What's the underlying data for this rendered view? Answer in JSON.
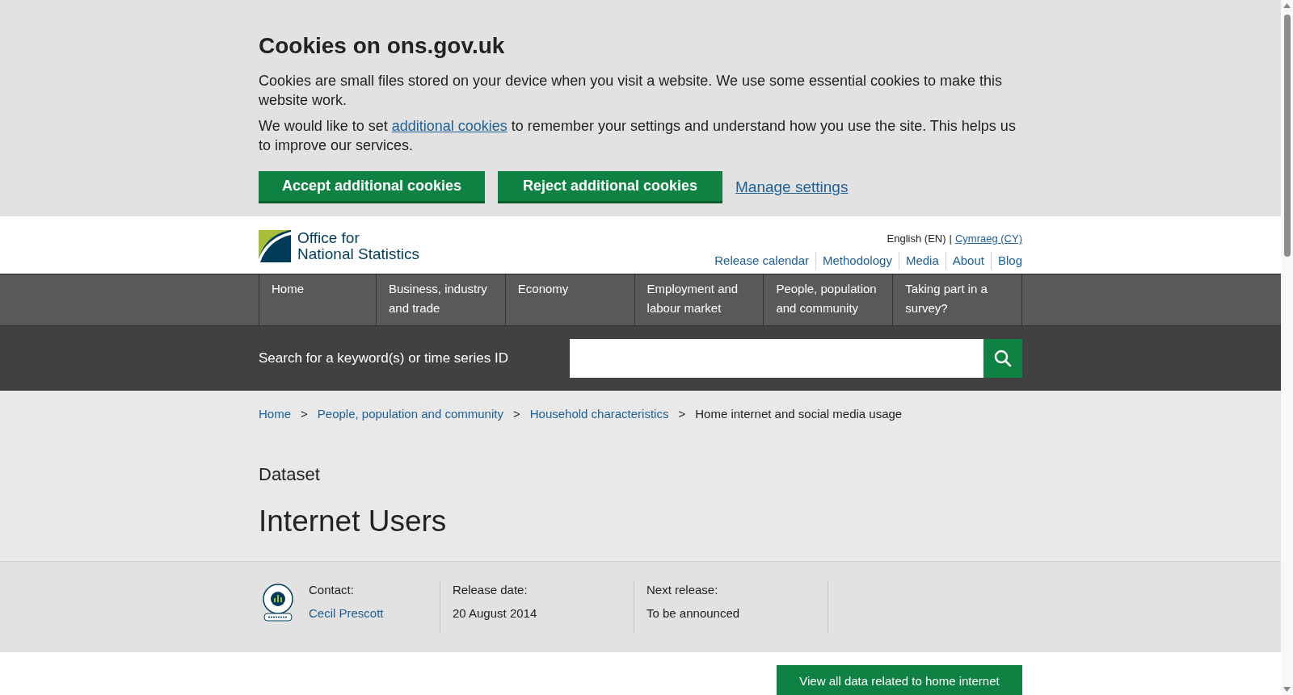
{
  "cookie_banner": {
    "title": "Cookies on ons.gov.uk",
    "paragraphs": [
      {
        "before": "Cookies are small files stored on your device when you visit a website. We use some essential cookies to make this website work."
      },
      {
        "before": "We would like to set ",
        "link": "additional cookies",
        "after": " to remember your settings and understand how you use the site. This helps us to improve our services."
      }
    ],
    "buttons": [
      "Accept additional cookies",
      "Reject additional cookies"
    ],
    "settings_link": "Manage settings"
  },
  "header": {
    "logo_lines": [
      "Office for",
      "National Statistics"
    ],
    "languages": [
      {
        "label": "English (EN)",
        "selected": true
      },
      {
        "label": "Cymraeg (CY)",
        "selected": false
      }
    ],
    "language_separator": "|",
    "utility_links": [
      "Release calendar",
      "Methodology",
      "Media",
      "About",
      "Blog"
    ]
  },
  "nav": [
    "Home",
    "Business, industry and trade",
    "Economy",
    "Employment and labour market",
    "People, population and community",
    "Taking part in a survey?"
  ],
  "search": {
    "label": "Search for a keyword(s) or time series ID"
  },
  "breadcrumbs": {
    "separator": ">",
    "items": [
      {
        "label": "Home",
        "current": false
      },
      {
        "label": "People, population and community",
        "current": false
      },
      {
        "label": "Household characteristics",
        "current": false
      },
      {
        "label": "Home internet and social media usage",
        "current": true
      }
    ]
  },
  "page": {
    "type": "Dataset",
    "title": "Internet Users"
  },
  "meta": [
    {
      "label": "Contact:",
      "value": "Cecil Prescott",
      "kind": "link"
    },
    {
      "label": "Release date:",
      "value": "20 August 2014",
      "kind": "text"
    },
    {
      "label": "Next release:",
      "value": "To be announced",
      "kind": "text"
    }
  ],
  "related_button": "View all data related to home internet"
}
